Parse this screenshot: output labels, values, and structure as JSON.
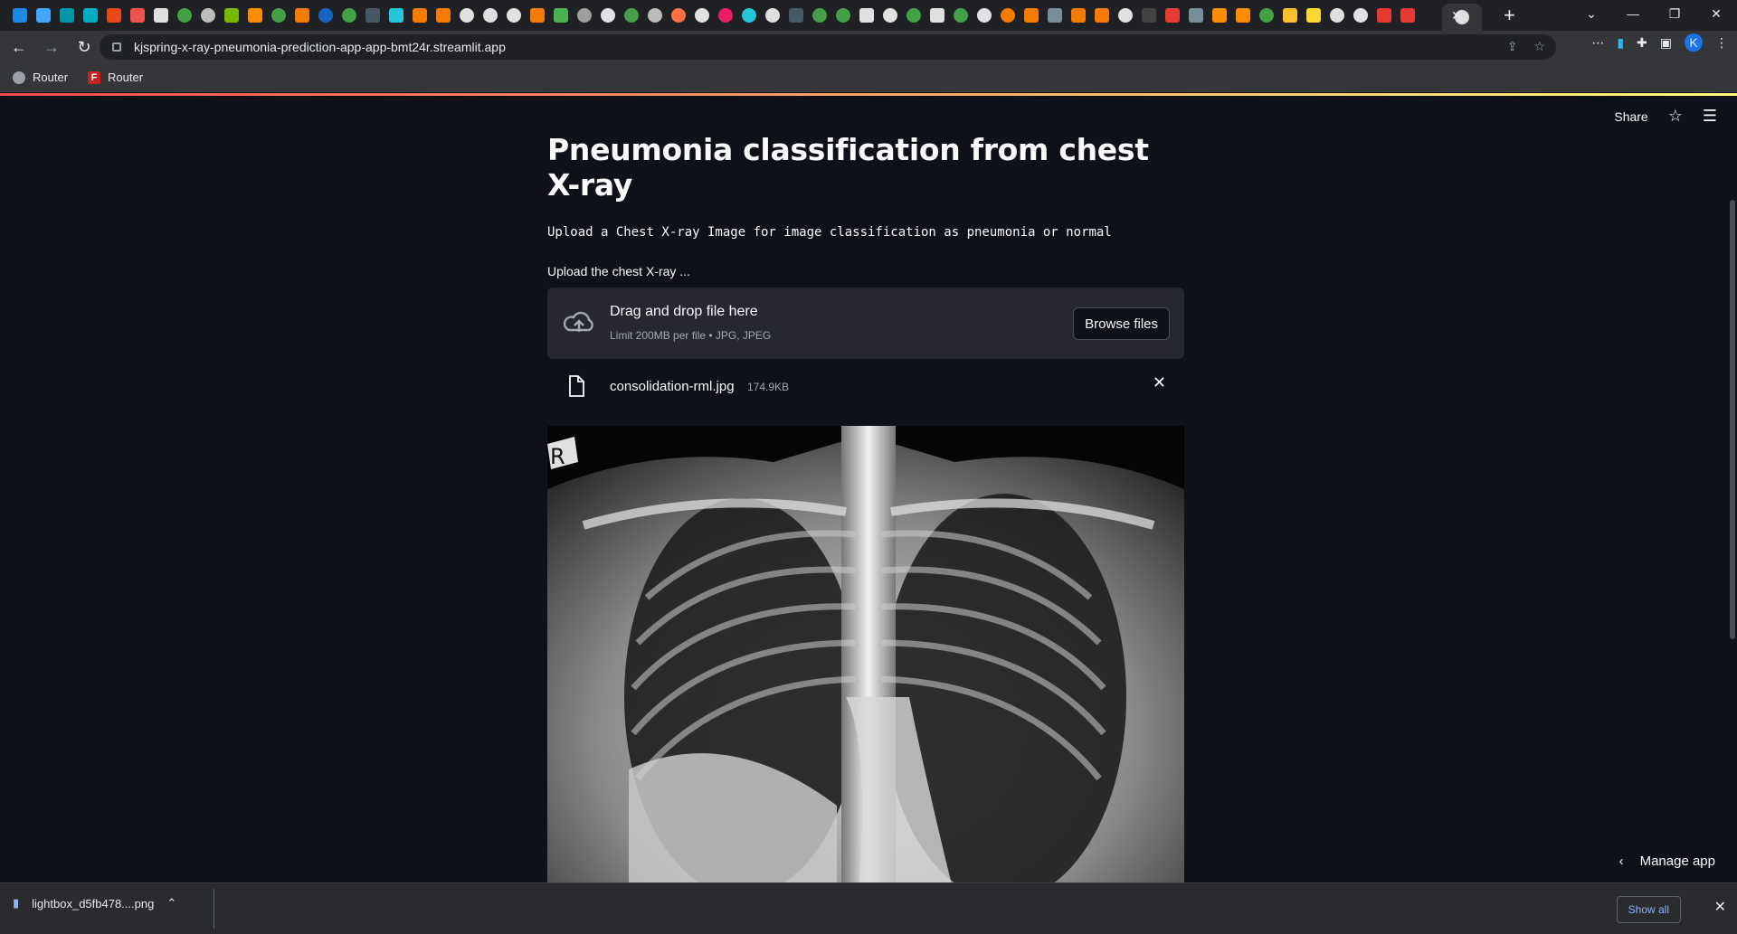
{
  "browser": {
    "url": "kjspring-x-ray-pneumonia-prediction-app-app-bmt24r.streamlit.app",
    "bookmarks": [
      {
        "label": "Router",
        "icon": "globe-icon"
      },
      {
        "label": "Router",
        "icon": "f-icon"
      }
    ],
    "profile_initial": "K"
  },
  "header": {
    "share_label": "Share"
  },
  "main": {
    "title": "Pneumonia classification from chest X-ray",
    "subtitle": "Upload a Chest X-ray Image for image classification as pneumonia or normal",
    "uploader_label": "Upload the chest X-ray ...",
    "dropzone_title": "Drag and drop file here",
    "dropzone_limit": "Limit 200MB per file • JPG, JPEG",
    "browse_label": "Browse files",
    "file_name": "consolidation-rml.jpg",
    "file_size": "174.9KB"
  },
  "manage_app_label": "Manage app",
  "downloads": {
    "file_name": "lightbox_d5fb478....png",
    "show_all_label": "Show all"
  },
  "colors": {
    "accent": "#ff4b4b",
    "background": "#0e1117",
    "secondary_bg": "#262730"
  }
}
